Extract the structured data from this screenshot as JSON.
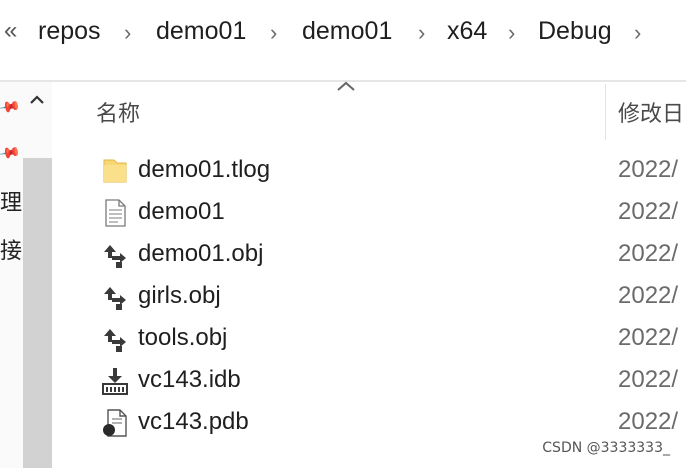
{
  "breadcrumb": {
    "overflow": "«",
    "items": [
      "repos",
      "demo01",
      "demo01",
      "x64",
      "Debug"
    ],
    "separator": "›"
  },
  "nav": {
    "labels": [
      "理",
      "接"
    ]
  },
  "columns": {
    "name": "名称",
    "date": "修改日"
  },
  "files": [
    {
      "name": "demo01.tlog",
      "date": "2022/",
      "icon": "folder-icon"
    },
    {
      "name": "demo01",
      "date": "2022/",
      "icon": "text-file-icon"
    },
    {
      "name": "demo01.obj",
      "date": "2022/",
      "icon": "obj-file-icon"
    },
    {
      "name": "girls.obj",
      "date": "2022/",
      "icon": "obj-file-icon"
    },
    {
      "name": "tools.obj",
      "date": "2022/",
      "icon": "obj-file-icon"
    },
    {
      "name": "vc143.idb",
      "date": "2022/",
      "icon": "idb-file-icon"
    },
    {
      "name": "vc143.pdb",
      "date": "2022/",
      "icon": "pdb-file-icon"
    }
  ],
  "watermark": "CSDN @3333333_",
  "colors": {
    "folder": "#f8d775",
    "scrollbar": "#d2d2d2",
    "header_text": "#4a4a4a"
  }
}
